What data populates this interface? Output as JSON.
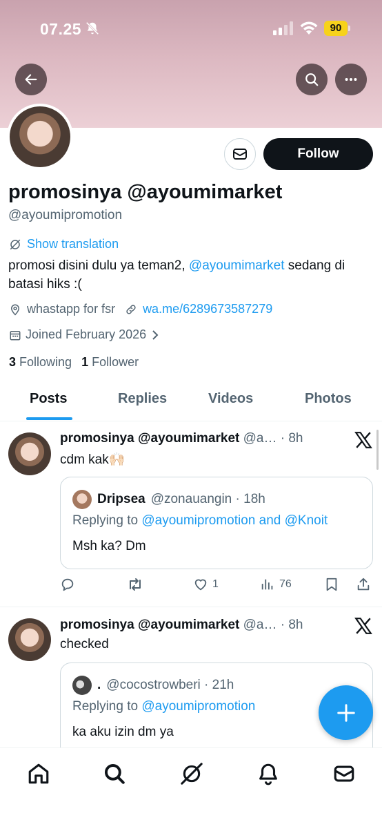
{
  "status_bar": {
    "time": "07.25",
    "battery": "90"
  },
  "profile": {
    "display_name": "promosinya @ayoumimarket",
    "handle": "@ayoumipromotion",
    "follow_label": "Follow",
    "show_translation": "Show translation",
    "bio_part1": "promosi disini dulu ya teman2, ",
    "bio_mention": "@ayoumimarket",
    "bio_part2": " sedang di batasi hiks :(",
    "location": "whastapp for fsr",
    "website": "wa.me/6289673587279",
    "joined": "Joined February 2026",
    "following_count": "3",
    "following_label": "Following",
    "followers_count": "1",
    "followers_label": "Follower"
  },
  "tabs": [
    {
      "label": "Posts"
    },
    {
      "label": "Replies"
    },
    {
      "label": "Videos"
    },
    {
      "label": "Photos"
    }
  ],
  "posts": [
    {
      "name": "promosinya @ayoumimarket",
      "meta": "@a… · 8h",
      "text": "cdm kak🙌🏻",
      "quote": {
        "name": "Dripsea",
        "meta": "@zonauangin · 18h",
        "reply_prefix": "Replying to ",
        "reply_mentions": "@ayoumipromotion and @Knoit",
        "text": "Msh ka? Dm"
      },
      "likes": "1",
      "views": "76"
    },
    {
      "name": "promosinya @ayoumimarket",
      "meta": "@a… · 8h",
      "text": "checked",
      "quote": {
        "name": ".",
        "meta": "@cocostrowberi · 21h",
        "reply_prefix": "Replying to ",
        "reply_mentions": "@ayoumipromotion",
        "text": "ka aku izin dm ya"
      }
    }
  ],
  "icons": {
    "back": "arrow-left-icon",
    "search": "search-icon",
    "more": "more-icon",
    "fab": "plus-icon",
    "nav": [
      "home-icon",
      "search-icon",
      "grok-icon",
      "bell-icon",
      "mail-icon"
    ]
  },
  "colors": {
    "accent": "#1d9bf0",
    "text": "#0f1419",
    "muted": "#536471",
    "battery": "#f7d21b"
  }
}
